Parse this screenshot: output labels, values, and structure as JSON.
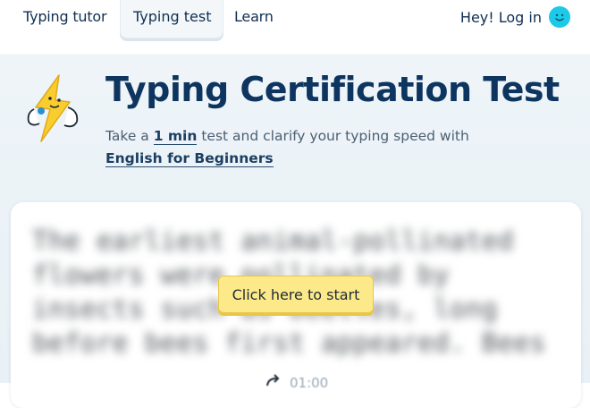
{
  "nav": {
    "items": [
      {
        "label": "Typing tutor"
      },
      {
        "label": "Typing test",
        "active": true
      },
      {
        "label": "Learn"
      }
    ],
    "login_label": "Hey! Log in",
    "avatar_icon": "smiley-face-icon",
    "avatar_color": "#1cc9e8"
  },
  "hero": {
    "mascot_icon": "lightning-bolt-mascot-icon",
    "title": "Typing Certification Test",
    "subtitle_pre": "Take a ",
    "duration": "1 min",
    "subtitle_mid": " test and clarify your typing speed with",
    "course": "English for Beginners"
  },
  "test": {
    "text": "The earliest animal-pollinated flowers were pollinated by insects such as beetles, long before bees first appeared. Bees",
    "start_label": "Click here to start",
    "timer_icon": "restart-arrow-icon",
    "timer": "01:00"
  },
  "colors": {
    "accent_title": "#0e355f",
    "start_button": "#fce98a"
  }
}
